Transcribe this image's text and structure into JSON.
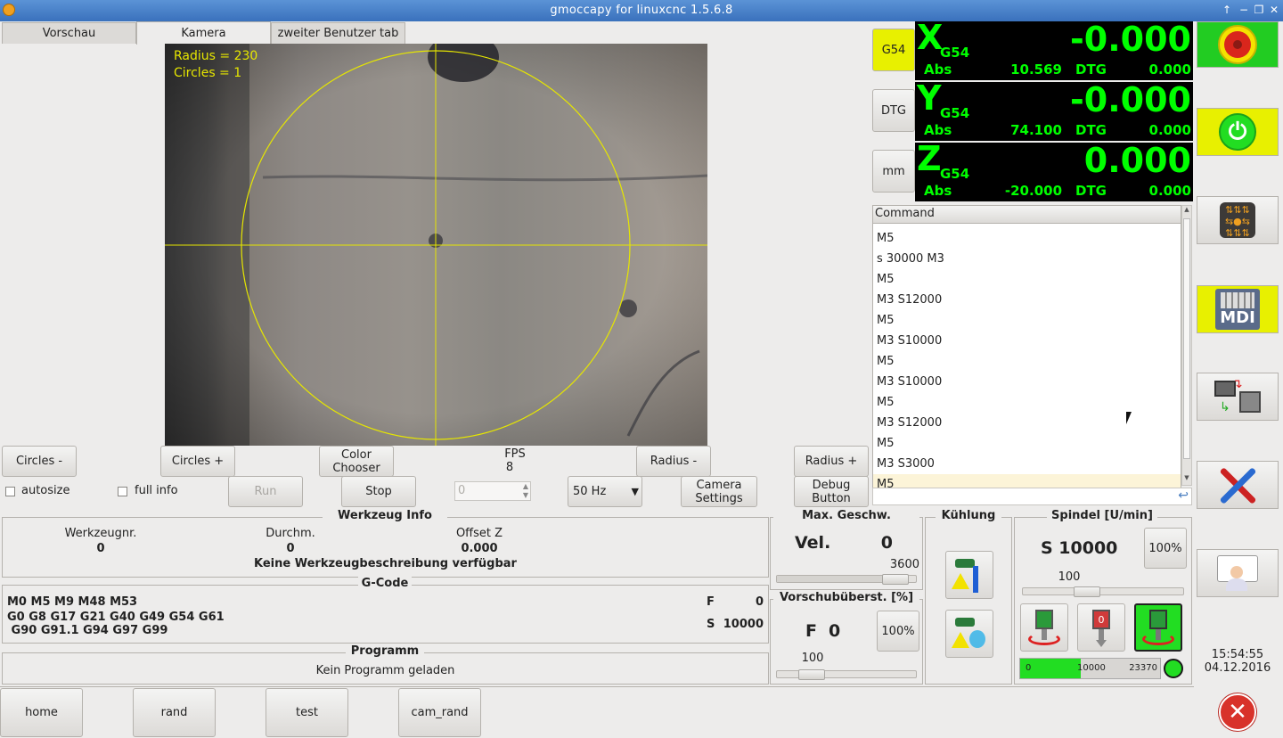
{
  "window": {
    "title": "gmoccapy for linuxcnc  1.5.6.8"
  },
  "tabs": [
    {
      "label": "Vorschau"
    },
    {
      "label": "Kamera"
    },
    {
      "label": "zweiter Benutzer tab"
    }
  ],
  "camera": {
    "radius_text": "Radius = 230",
    "circles_text": "Circles = 1"
  },
  "cam_controls": {
    "circles_minus": "Circles -",
    "circles_plus": "Circles +",
    "color_chooser": "Color Chooser",
    "fps_label": "FPS",
    "fps_value": "8",
    "radius_minus": "Radius -",
    "radius_plus": "Radius +",
    "autosize": "autosize",
    "full_info": "full info",
    "run": "Run",
    "stop": "Stop",
    "spin_value": "0",
    "freq": "50 Hz",
    "camera_settings": "Camera Settings",
    "debug_button": "Debug Button"
  },
  "dro": {
    "mode_buttons": [
      "G54",
      "DTG",
      "mm"
    ],
    "axes": [
      {
        "axis": "X",
        "sys": "G54",
        "value": "-0.000",
        "abs_label": "Abs",
        "abs": "10.569",
        "dtg_label": "DTG",
        "dtg": "0.000"
      },
      {
        "axis": "Y",
        "sys": "G54",
        "value": "-0.000",
        "abs_label": "Abs",
        "abs": "74.100",
        "dtg_label": "DTG",
        "dtg": "0.000"
      },
      {
        "axis": "Z",
        "sys": "G54",
        "value": "0.000",
        "abs_label": "Abs",
        "abs": "-20.000",
        "dtg_label": "DTG",
        "dtg": "0.000"
      }
    ]
  },
  "history": {
    "header": "Command",
    "items": [
      "M5",
      "s 30000 M3",
      "M5",
      "M3 S12000",
      "M5",
      "M3 S10000",
      "M5",
      "M3 S10000",
      "M5",
      "M3 S12000",
      "M5",
      "M3 S3000",
      "M5"
    ]
  },
  "sidebar": {
    "mdi_label": "MDI"
  },
  "tool": {
    "title": "Werkzeug Info",
    "nr_label": "Werkzeugnr.",
    "nr": "0",
    "dia_label": "Durchm.",
    "dia": "0",
    "offset_label": "Offset Z",
    "offset": "0.000",
    "desc": "Keine Werkzeugbeschreibung verfügbar"
  },
  "gcode": {
    "title": "G-Code",
    "line1": "M0 M5 M9 M48 M53",
    "line2": "G0 G8 G17 G21 G40 G49 G54 G61",
    "line3": " G90 G91.1 G94 G97 G99",
    "f_label": "F",
    "f": "0",
    "s_label": "S",
    "s": "10000"
  },
  "program": {
    "title": "Programm",
    "text": "Kein Programm geladen"
  },
  "velocity": {
    "title": "Max. Geschw.",
    "vel_label": "Vel.",
    "vel": "0",
    "max": "3600",
    "max_level": 0.85
  },
  "feed": {
    "title": "Vorschubüberst. [%]",
    "f_label": "F",
    "f": "0",
    "btn": "100%",
    "value": "100",
    "level": 0.25
  },
  "coolant": {
    "title": "Kühlung"
  },
  "spindle": {
    "title": "Spindel [U/min]",
    "s": "S 10000",
    "btn": "100%",
    "override": "100",
    "override_level": 0.4,
    "bar_min": "0",
    "bar_mid": "10000",
    "bar_max": "23370",
    "bar_level": 0.43
  },
  "clock": {
    "time": "15:54:55",
    "date": "04.12.2016"
  },
  "bottom": [
    "home",
    "rand",
    "test",
    "cam_rand"
  ],
  "colors": {
    "dro_fg": "#00ff00",
    "dro_bg": "#000000",
    "active": "#e8f000",
    "ok": "#22dd22"
  }
}
